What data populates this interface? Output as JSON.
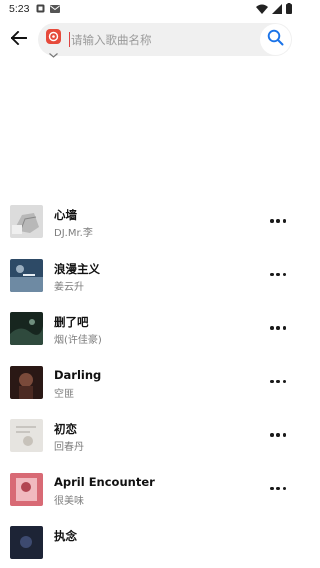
{
  "status_bar": {
    "time": "5:23",
    "icons": [
      "square-notification-icon",
      "mail-icon",
      "wifi-icon",
      "signal-icon",
      "battery-icon"
    ]
  },
  "header": {
    "back_icon": "arrow-left-icon",
    "source_icon": "music-app-icon",
    "search": {
      "value": "",
      "placeholder": "请输入歌曲名称"
    },
    "search_icon": "search-icon"
  },
  "songs": [
    {
      "title": "心墙",
      "artist": "DJ.Mr.李"
    },
    {
      "title": "浪漫主义",
      "artist": "姜云升"
    },
    {
      "title": "删了吧",
      "artist": "烟(许佳豪)"
    },
    {
      "title": "Darling",
      "artist": "空匪"
    },
    {
      "title": "初恋",
      "artist": "回春丹"
    },
    {
      "title": "April Encounter",
      "artist": "很美味"
    },
    {
      "title": "执念",
      "artist": ""
    }
  ],
  "colors": {
    "accent": "#1a73e8",
    "badge": "#e64a3b",
    "search_bg": "#f0f0f0"
  }
}
